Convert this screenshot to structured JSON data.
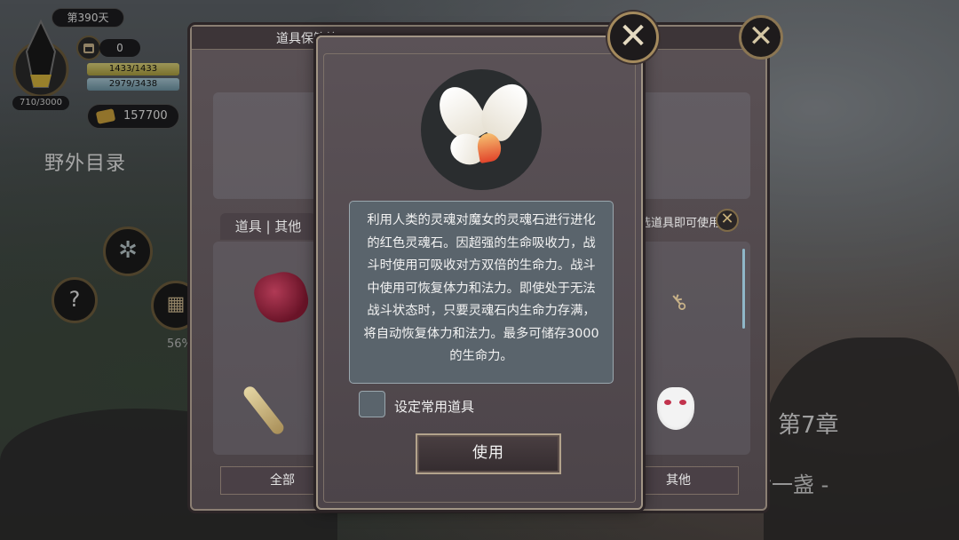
{
  "hud": {
    "day": "第390天",
    "count": "0",
    "hp": "1433/1433",
    "mp": "2979/3438",
    "xp": "710/3000",
    "gold": "157700"
  },
  "map": {
    "title": "野外目录",
    "progress": "56%",
    "question": "?"
  },
  "background": {
    "chapter": "第7章",
    "lamp_text": "后一盏 -"
  },
  "storage": {
    "title": "道具保管箱",
    "tab_left": "道具 | 其他",
    "hint": "选道具即可使用",
    "bottom_all": "全部",
    "bottom_other": "其他"
  },
  "dialog": {
    "description": "利用人类的灵魂对魔女的灵魂石进行进化的红色灵魂石。因超强的生命吸收力，战斗时使用可吸收对方双倍的生命力。战斗中使用可恢复体力和法力。即使处于无法战斗状态时，只要灵魂石内生命力存满，将自动恢复体力和法力。最多可储存3000的生命力。",
    "checkbox_label": "设定常用道具",
    "use_button": "使用"
  },
  "icons": {
    "close": "close-icon",
    "item": "soul-stone-icon"
  }
}
